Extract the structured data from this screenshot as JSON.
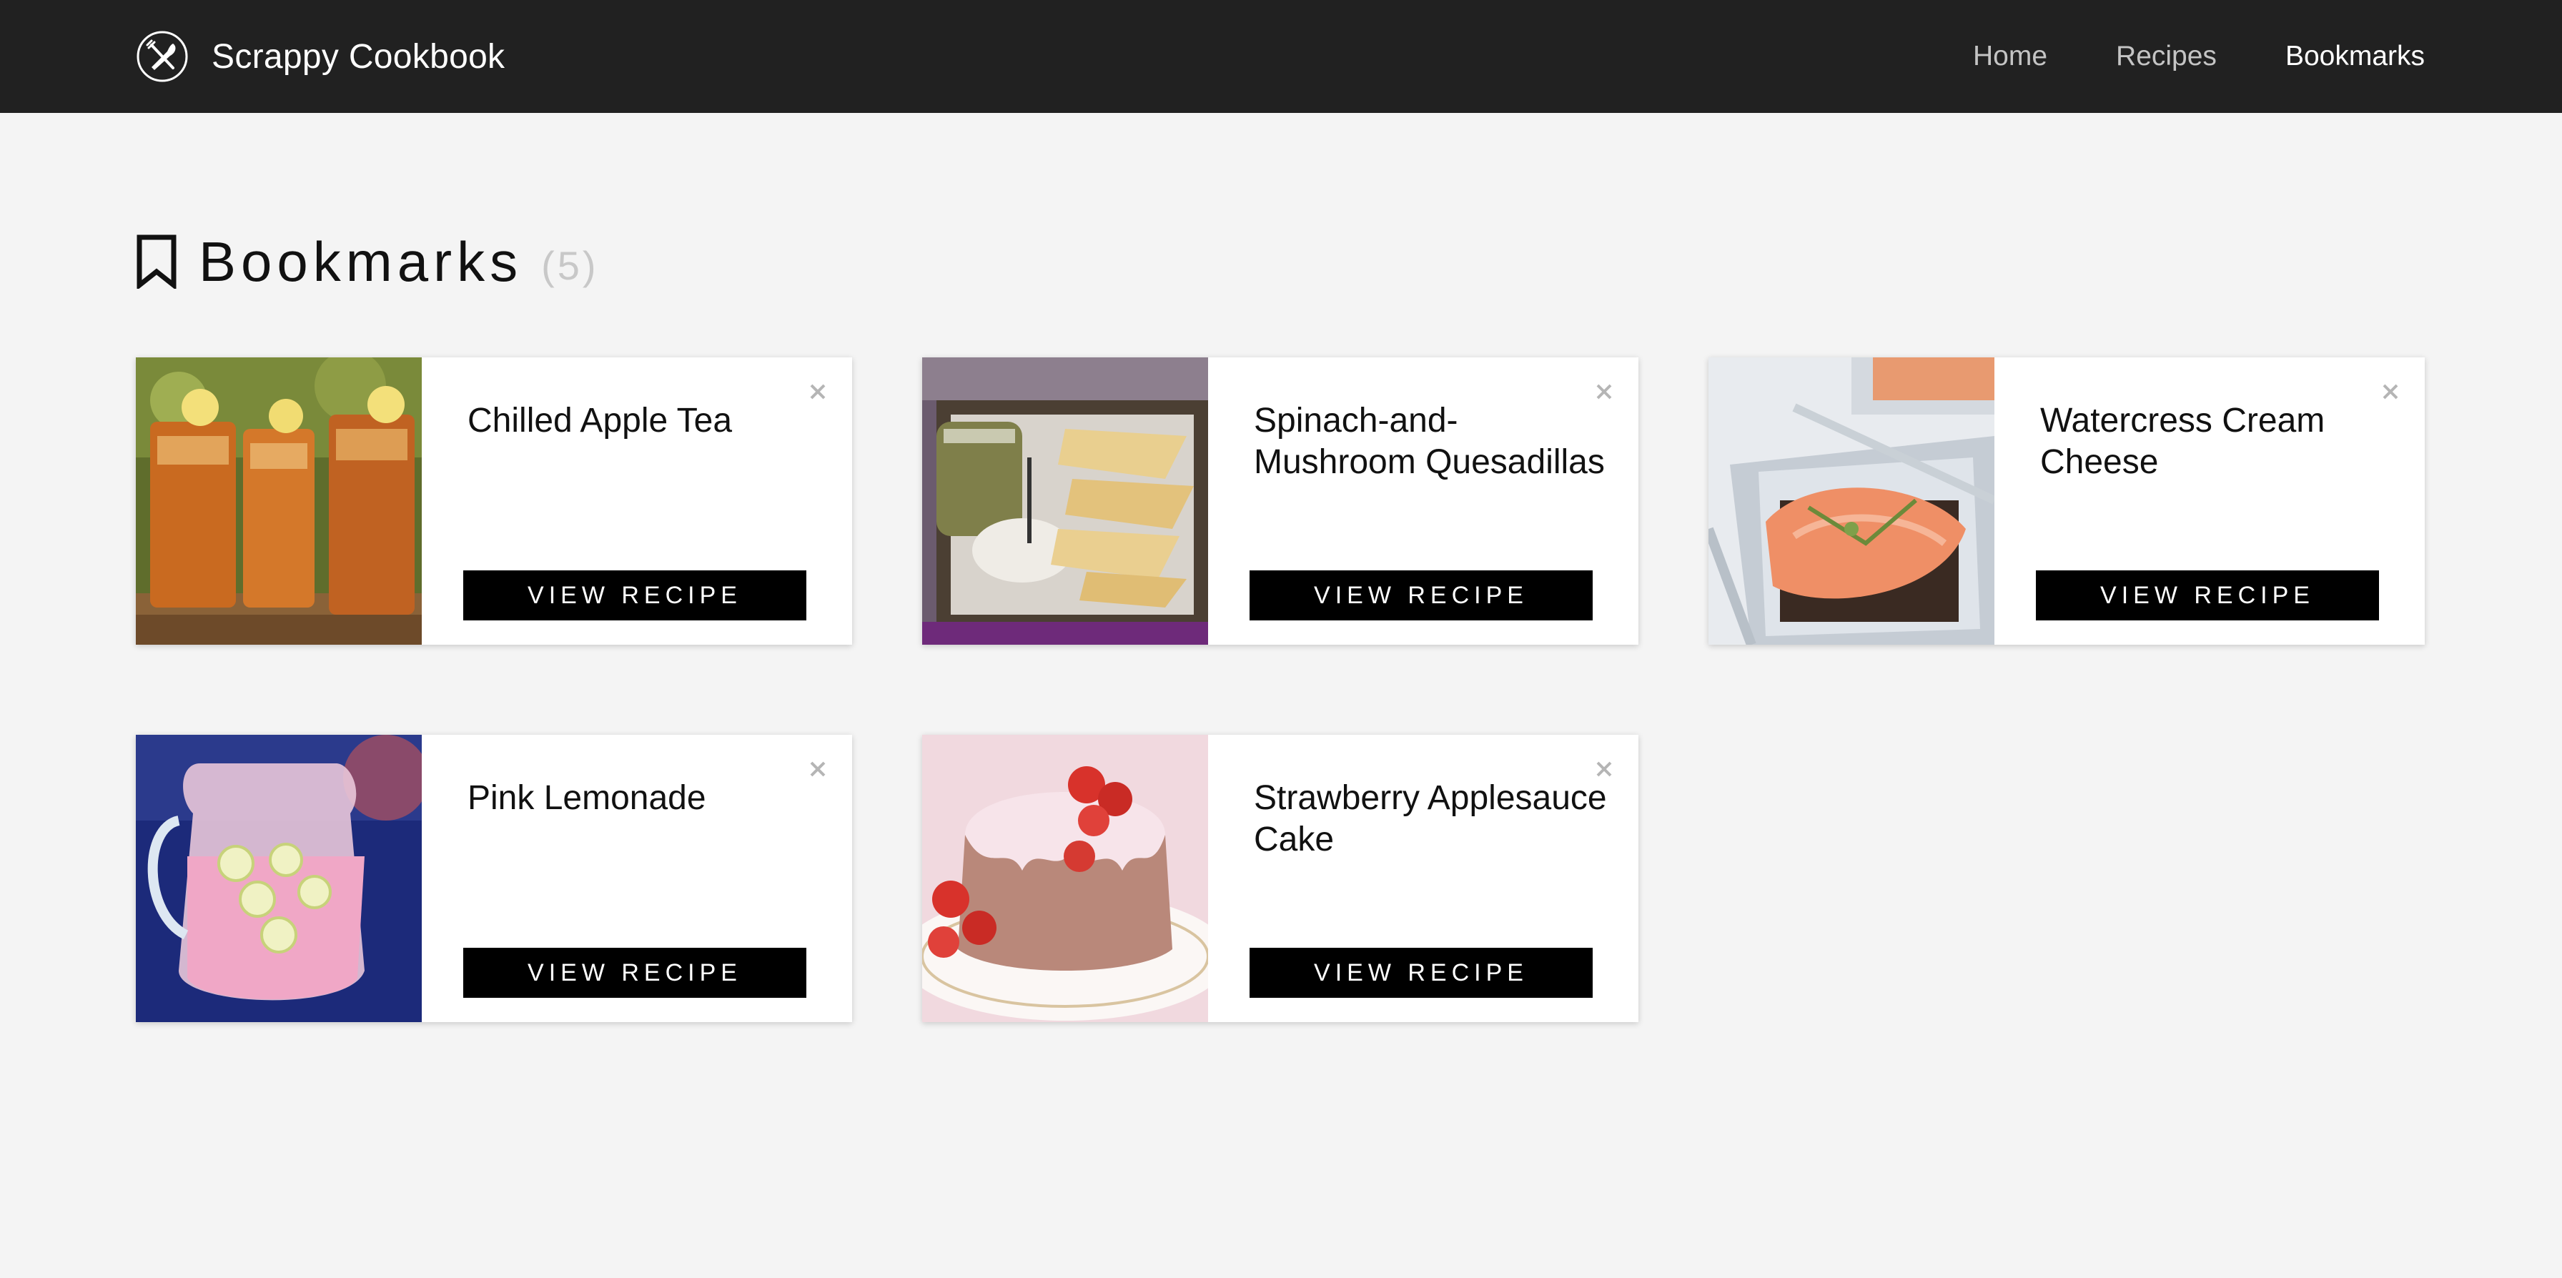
{
  "app": {
    "brand_name": "Scrappy Cookbook",
    "logo_icon": "fork-knife-circle-icon"
  },
  "nav": {
    "items": [
      {
        "label": "Home",
        "active": false
      },
      {
        "label": "Recipes",
        "active": false
      },
      {
        "label": "Bookmarks",
        "active": true
      }
    ]
  },
  "page": {
    "title": "Bookmarks",
    "count": "(5)",
    "title_icon": "bookmark-icon"
  },
  "cards": [
    {
      "title": "Chilled Apple Tea",
      "button": "VIEW RECIPE",
      "image": "iced-tea-glasses-photo"
    },
    {
      "title": "Spinach-and-Mushroom Quesadillas",
      "button": "VIEW RECIPE",
      "image": "quesadillas-tray-photo"
    },
    {
      "title": "Watercress Cream Cheese",
      "button": "VIEW RECIPE",
      "image": "smoked-salmon-toast-photo"
    },
    {
      "title": "Pink Lemonade",
      "button": "VIEW RECIPE",
      "image": "pink-lemonade-pitcher-photo"
    },
    {
      "title": "Strawberry Applesauce Cake",
      "button": "VIEW RECIPE",
      "image": "strawberry-bundt-cake-photo"
    }
  ],
  "colors": {
    "navbar_bg": "#212121",
    "page_bg": "#f4f4f4",
    "button_bg": "#000000",
    "count_text": "#c8c8c8"
  }
}
